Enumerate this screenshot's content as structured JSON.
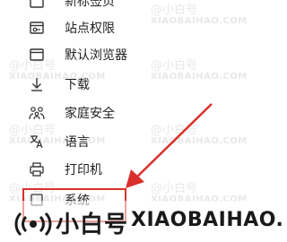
{
  "menu": {
    "items": [
      {
        "label": "新标签页",
        "icon": "new-tab-icon"
      },
      {
        "label": "站点权限",
        "icon": "site-permissions-icon"
      },
      {
        "label": "默认浏览器",
        "icon": "default-browser-icon"
      },
      {
        "label": "下载",
        "icon": "download-icon"
      },
      {
        "label": "家庭安全",
        "icon": "family-safety-icon"
      },
      {
        "label": "语言",
        "icon": "language-icon"
      },
      {
        "label": "打印机",
        "icon": "printer-icon"
      },
      {
        "label": "系统",
        "icon": "system-icon"
      }
    ]
  },
  "watermark": {
    "tile_cn": "@小白号",
    "tile_en": "XIAOBAIHAO.COM",
    "brand_cn": "小白号",
    "brand_en": "XIAOBAIHAO.COM"
  },
  "colors": {
    "highlight": "#d9302c",
    "text": "#1f1f1f",
    "watermark": "#e8e8e8"
  }
}
